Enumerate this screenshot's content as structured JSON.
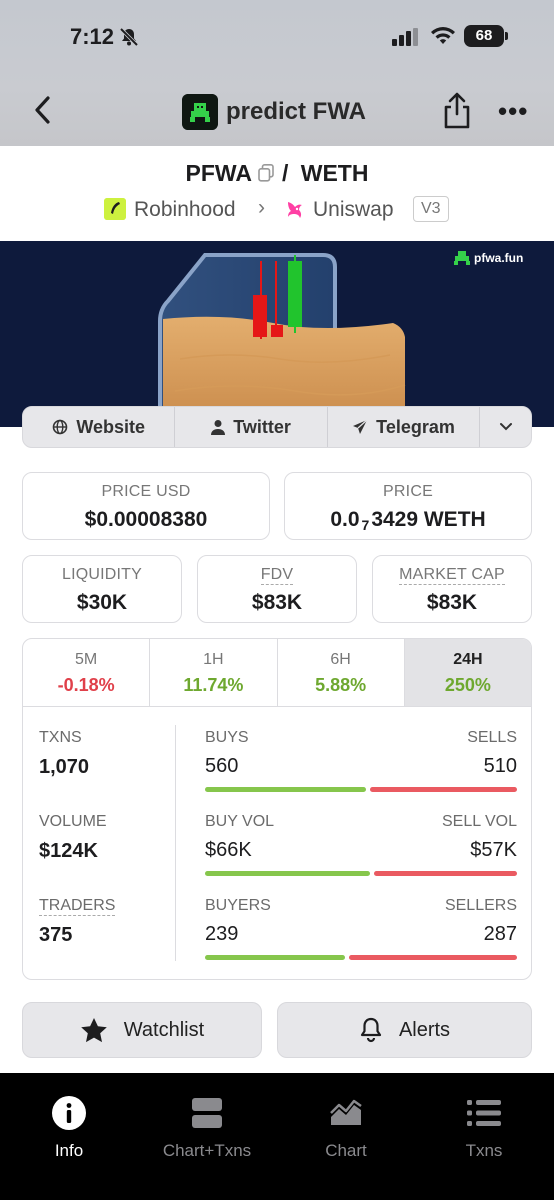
{
  "status_bar": {
    "time": "7:12",
    "battery": "68"
  },
  "nav": {
    "title": "predict FWA"
  },
  "pair": {
    "base": "PFWA",
    "separator": "/",
    "quote": "WETH"
  },
  "chain": {
    "network": "Robinhood",
    "dex": "Uniswap",
    "version": "V3"
  },
  "banner": {
    "watermark": "pfwa.fun"
  },
  "links": [
    {
      "label": "Website",
      "icon": "globe-icon"
    },
    {
      "label": "Twitter",
      "icon": "person-icon"
    },
    {
      "label": "Telegram",
      "icon": "send-icon"
    }
  ],
  "metrics": {
    "price_usd": {
      "label": "PRICE USD",
      "value": "$0.00008380"
    },
    "price": {
      "label": "PRICE",
      "prefix": "0.0",
      "sub": "7",
      "rest": "3429 WETH"
    },
    "liquidity": {
      "label": "LIQUIDITY",
      "value": "$30K"
    },
    "fdv": {
      "label": "FDV",
      "value": "$83K"
    },
    "market_cap": {
      "label": "MARKET CAP",
      "value": "$83K"
    }
  },
  "timeframes": [
    {
      "label": "5M",
      "change": "-0.18%",
      "color": "#e0404a"
    },
    {
      "label": "1H",
      "change": "11.74%",
      "color": "#6ea82f"
    },
    {
      "label": "6H",
      "change": "5.88%",
      "color": "#6ea82f"
    },
    {
      "label": "24H",
      "change": "250%",
      "color": "#6ea82f",
      "selected": true
    }
  ],
  "stats": {
    "txns": {
      "label": "TXNS",
      "value": "1,070"
    },
    "volume": {
      "label": "VOLUME",
      "value": "$124K"
    },
    "traders": {
      "label": "TRADERS",
      "value": "375"
    },
    "buys": {
      "label": "BUYS",
      "value": "560",
      "ratio": 0.523
    },
    "sells": {
      "label": "SELLS",
      "value": "510"
    },
    "buy_vol": {
      "label": "BUY VOL",
      "value": "$66K",
      "ratio": 0.537
    },
    "sell_vol": {
      "label": "SELL VOL",
      "value": "$57K"
    },
    "buyers": {
      "label": "BUYERS",
      "value": "239",
      "ratio": 0.454
    },
    "sellers": {
      "label": "SELLERS",
      "value": "287"
    }
  },
  "actions": {
    "watchlist": "Watchlist",
    "alerts": "Alerts"
  },
  "tabbar": [
    {
      "label": "Info",
      "icon": "info-icon",
      "active": true
    },
    {
      "label": "Chart+Txns",
      "icon": "split-view-icon"
    },
    {
      "label": "Chart",
      "icon": "area-chart-icon"
    },
    {
      "label": "Txns",
      "icon": "list-icon"
    }
  ],
  "colors": {
    "buy": "#86c64c",
    "sell": "#ea5a61",
    "banner_bg": "#0e1a3c"
  }
}
